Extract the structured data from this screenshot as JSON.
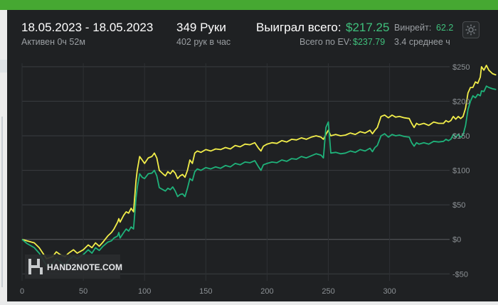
{
  "header": {
    "date_range": "18.05.2023 - 18.05.2023",
    "active_time": "Активен 0ч 52м",
    "hands": "349 Руки",
    "hands_per_hour": "402 рук в час",
    "won_total_label": "Выиграл всего:",
    "won_total_value": "$217.25",
    "ev_total_label": "Всего по EV:",
    "ev_total_value": "$237.79",
    "winrate_label": "Винрейт:",
    "winrate_value": "62.2",
    "avg_label": "3.4 среднее ч"
  },
  "watermark": "HAND2NOTE.COM",
  "colors": {
    "won_line": "#1fb27a",
    "ev_line": "#f2ee4a",
    "accent_green": "#3fc07c",
    "panel_bg": "#1f2123"
  },
  "chart_data": {
    "type": "line",
    "xlim": [
      0,
      349
    ],
    "ylim": [
      -60,
      255
    ],
    "x_ticks": [
      0,
      50,
      100,
      150,
      200,
      250,
      300
    ],
    "y_ticks": [
      250,
      200,
      150,
      100,
      50,
      0,
      -50
    ],
    "y_tick_labels": [
      "$250",
      "$200",
      "$150",
      "$100",
      "$50",
      "$0",
      "-$50"
    ],
    "grid": true,
    "series": [
      {
        "key": "ev",
        "color": "#f2ee4a",
        "points": [
          [
            0,
            0
          ],
          [
            4,
            -2
          ],
          [
            10,
            -5
          ],
          [
            14,
            -12
          ],
          [
            20,
            -28
          ],
          [
            25,
            -25
          ],
          [
            28,
            -18
          ],
          [
            31,
            -22
          ],
          [
            35,
            -25
          ],
          [
            38,
            -20
          ],
          [
            42,
            -15
          ],
          [
            45,
            -20
          ],
          [
            50,
            -15
          ],
          [
            54,
            -8
          ],
          [
            57,
            -12
          ],
          [
            60,
            -5
          ],
          [
            63,
            -10
          ],
          [
            66,
            -4
          ],
          [
            70,
            5
          ],
          [
            73,
            10
          ],
          [
            75,
            15
          ],
          [
            78,
            25
          ],
          [
            79,
            30
          ],
          [
            80,
            25
          ],
          [
            83,
            35
          ],
          [
            85,
            40
          ],
          [
            87,
            38
          ],
          [
            89,
            45
          ],
          [
            91,
            40
          ],
          [
            93,
            85
          ],
          [
            94,
            100
          ],
          [
            96,
            120
          ],
          [
            98,
            115
          ],
          [
            100,
            110
          ],
          [
            103,
            118
          ],
          [
            106,
            120
          ],
          [
            108,
            125
          ],
          [
            110,
            118
          ],
          [
            112,
            100
          ],
          [
            115,
            95
          ],
          [
            117,
            92
          ],
          [
            119,
            98
          ],
          [
            121,
            95
          ],
          [
            123,
            100
          ],
          [
            125,
            96
          ],
          [
            127,
            88
          ],
          [
            129,
            92
          ],
          [
            131,
            94
          ],
          [
            133,
            90
          ],
          [
            135,
            100
          ],
          [
            137,
            115
          ],
          [
            139,
            110
          ],
          [
            141,
            125
          ],
          [
            143,
            128
          ],
          [
            146,
            126
          ],
          [
            150,
            130
          ],
          [
            154,
            128
          ],
          [
            158,
            131
          ],
          [
            162,
            130
          ],
          [
            166,
            133
          ],
          [
            170,
            131
          ],
          [
            174,
            136
          ],
          [
            178,
            134
          ],
          [
            182,
            138
          ],
          [
            186,
            137
          ],
          [
            190,
            140
          ],
          [
            193,
            132
          ],
          [
            195,
            128
          ],
          [
            197,
            135
          ],
          [
            200,
            138
          ],
          [
            204,
            140
          ],
          [
            208,
            139
          ],
          [
            212,
            143
          ],
          [
            216,
            141
          ],
          [
            220,
            145
          ],
          [
            224,
            144
          ],
          [
            228,
            147
          ],
          [
            232,
            145
          ],
          [
            236,
            148
          ],
          [
            240,
            150
          ],
          [
            244,
            148
          ],
          [
            246,
            145
          ],
          [
            248,
            152
          ],
          [
            250,
            158
          ],
          [
            252,
            150
          ],
          [
            256,
            152
          ],
          [
            260,
            150
          ],
          [
            264,
            151
          ],
          [
            268,
            154
          ],
          [
            272,
            152
          ],
          [
            276,
            156
          ],
          [
            280,
            154
          ],
          [
            284,
            158
          ],
          [
            286,
            153
          ],
          [
            288,
            158
          ],
          [
            290,
            162
          ],
          [
            293,
            178
          ],
          [
            296,
            180
          ],
          [
            299,
            176
          ],
          [
            302,
            180
          ],
          [
            305,
            177
          ],
          [
            308,
            178
          ],
          [
            312,
            176
          ],
          [
            316,
            175
          ],
          [
            318,
            168
          ],
          [
            320,
            162
          ],
          [
            322,
            168
          ],
          [
            324,
            166
          ],
          [
            328,
            168
          ],
          [
            332,
            165
          ],
          [
            336,
            170
          ],
          [
            340,
            168
          ],
          [
            344,
            168
          ],
          [
            346,
            172
          ],
          [
            348,
            170
          ],
          [
            350,
            172
          ],
          [
            352,
            178
          ],
          [
            354,
            174
          ],
          [
            356,
            178
          ],
          [
            358,
            175
          ],
          [
            360,
            178
          ],
          [
            362,
            190
          ],
          [
            364,
            212
          ],
          [
            366,
            220
          ],
          [
            368,
            220
          ],
          [
            370,
            228
          ],
          [
            372,
            226
          ],
          [
            374,
            235
          ],
          [
            375,
            250
          ],
          [
            377,
            245
          ],
          [
            379,
            252
          ],
          [
            381,
            245
          ],
          [
            384,
            240
          ],
          [
            387,
            238
          ]
        ]
      },
      {
        "key": "won",
        "color": "#1fb27a",
        "points": [
          [
            0,
            0
          ],
          [
            4,
            -6
          ],
          [
            10,
            -12
          ],
          [
            14,
            -20
          ],
          [
            20,
            -38
          ],
          [
            25,
            -35
          ],
          [
            28,
            -28
          ],
          [
            31,
            -32
          ],
          [
            35,
            -38
          ],
          [
            38,
            -30
          ],
          [
            42,
            -24
          ],
          [
            45,
            -28
          ],
          [
            50,
            -22
          ],
          [
            54,
            -15
          ],
          [
            57,
            -20
          ],
          [
            60,
            -12
          ],
          [
            63,
            -16
          ],
          [
            66,
            -10
          ],
          [
            70,
            -4
          ],
          [
            73,
            -2
          ],
          [
            75,
            2
          ],
          [
            78,
            5
          ],
          [
            79,
            10
          ],
          [
            80,
            2
          ],
          [
            83,
            10
          ],
          [
            85,
            15
          ],
          [
            87,
            12
          ],
          [
            89,
            18
          ],
          [
            91,
            15
          ],
          [
            93,
            60
          ],
          [
            94,
            75
          ],
          [
            96,
            95
          ],
          [
            98,
            90
          ],
          [
            100,
            88
          ],
          [
            103,
            95
          ],
          [
            106,
            96
          ],
          [
            108,
            100
          ],
          [
            110,
            92
          ],
          [
            112,
            75
          ],
          [
            115,
            72
          ],
          [
            117,
            70
          ],
          [
            119,
            74
          ],
          [
            121,
            72
          ],
          [
            123,
            76
          ],
          [
            125,
            70
          ],
          [
            127,
            62
          ],
          [
            129,
            65
          ],
          [
            131,
            66
          ],
          [
            133,
            62
          ],
          [
            135,
            74
          ],
          [
            137,
            88
          ],
          [
            139,
            85
          ],
          [
            141,
            98
          ],
          [
            143,
            102
          ],
          [
            146,
            100
          ],
          [
            150,
            104
          ],
          [
            154,
            102
          ],
          [
            158,
            105
          ],
          [
            162,
            103
          ],
          [
            166,
            107
          ],
          [
            170,
            105
          ],
          [
            174,
            110
          ],
          [
            178,
            108
          ],
          [
            182,
            112
          ],
          [
            186,
            111
          ],
          [
            190,
            114
          ],
          [
            193,
            105
          ],
          [
            195,
            100
          ],
          [
            197,
            108
          ],
          [
            200,
            110
          ],
          [
            204,
            112
          ],
          [
            208,
            111
          ],
          [
            212,
            115
          ],
          [
            216,
            113
          ],
          [
            220,
            117
          ],
          [
            224,
            116
          ],
          [
            228,
            120
          ],
          [
            232,
            118
          ],
          [
            236,
            121
          ],
          [
            240,
            124
          ],
          [
            244,
            122
          ],
          [
            246,
            118
          ],
          [
            248,
            162
          ],
          [
            250,
            170
          ],
          [
            252,
            125
          ],
          [
            256,
            126
          ],
          [
            260,
            124
          ],
          [
            264,
            125
          ],
          [
            268,
            128
          ],
          [
            272,
            126
          ],
          [
            276,
            130
          ],
          [
            280,
            128
          ],
          [
            284,
            132
          ],
          [
            286,
            127
          ],
          [
            288,
            133
          ],
          [
            290,
            136
          ],
          [
            293,
            150
          ],
          [
            296,
            153
          ],
          [
            299,
            148
          ],
          [
            302,
            152
          ],
          [
            305,
            150
          ],
          [
            308,
            151
          ],
          [
            312,
            149
          ],
          [
            316,
            148
          ],
          [
            318,
            140
          ],
          [
            320,
            135
          ],
          [
            322,
            140
          ],
          [
            324,
            138
          ],
          [
            328,
            140
          ],
          [
            332,
            138
          ],
          [
            336,
            142
          ],
          [
            340,
            141
          ],
          [
            344,
            142
          ],
          [
            346,
            145
          ],
          [
            348,
            143
          ],
          [
            350,
            145
          ],
          [
            352,
            152
          ],
          [
            354,
            148
          ],
          [
            356,
            152
          ],
          [
            358,
            148
          ],
          [
            360,
            151
          ],
          [
            362,
            165
          ],
          [
            364,
            188
          ],
          [
            366,
            200
          ],
          [
            368,
            208
          ],
          [
            370,
            205
          ],
          [
            372,
            210
          ],
          [
            374,
            208
          ],
          [
            375,
            215
          ],
          [
            377,
            214
          ],
          [
            379,
            222
          ],
          [
            381,
            220
          ],
          [
            384,
            218
          ],
          [
            387,
            217
          ]
        ]
      }
    ]
  }
}
